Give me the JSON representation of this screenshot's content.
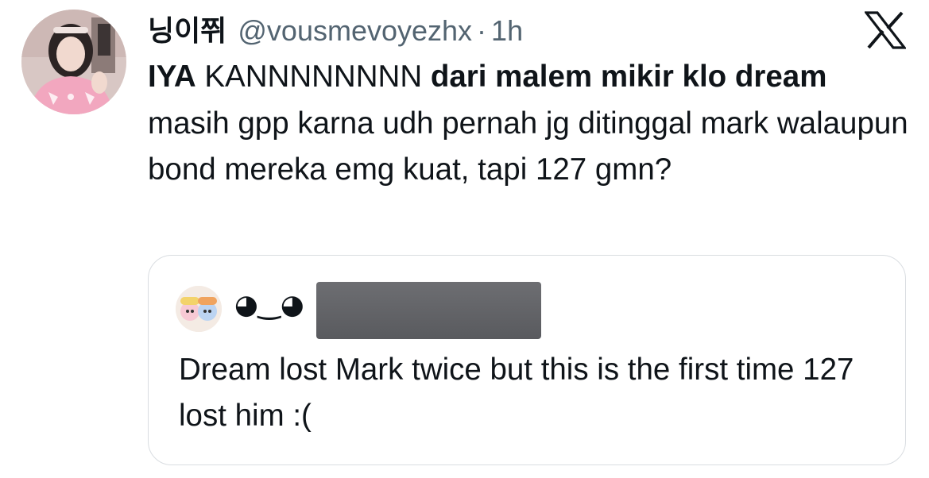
{
  "author": {
    "display_name": "닝이쮜",
    "handle": "@vousmevoyezhx",
    "separator": "·",
    "time": "1h"
  },
  "post": {
    "seg1_bold": "IYA",
    "seg2": " KANNNNNNNN ",
    "seg3_bold": "dari malem mikir klo dream",
    "seg4": " masih gpp karna udh pernah jg ditinggal mark walaupun bond mereka emg kuat, tapi 127 gmn?"
  },
  "quote": {
    "display_name": "◕‿◕",
    "text": "Dream lost Mark twice but this is the first time 127 lost him :("
  },
  "icons": {
    "platform": "x-logo-icon",
    "author_avatar": "profile-photo",
    "quote_avatar": "cartoon-avatar"
  }
}
